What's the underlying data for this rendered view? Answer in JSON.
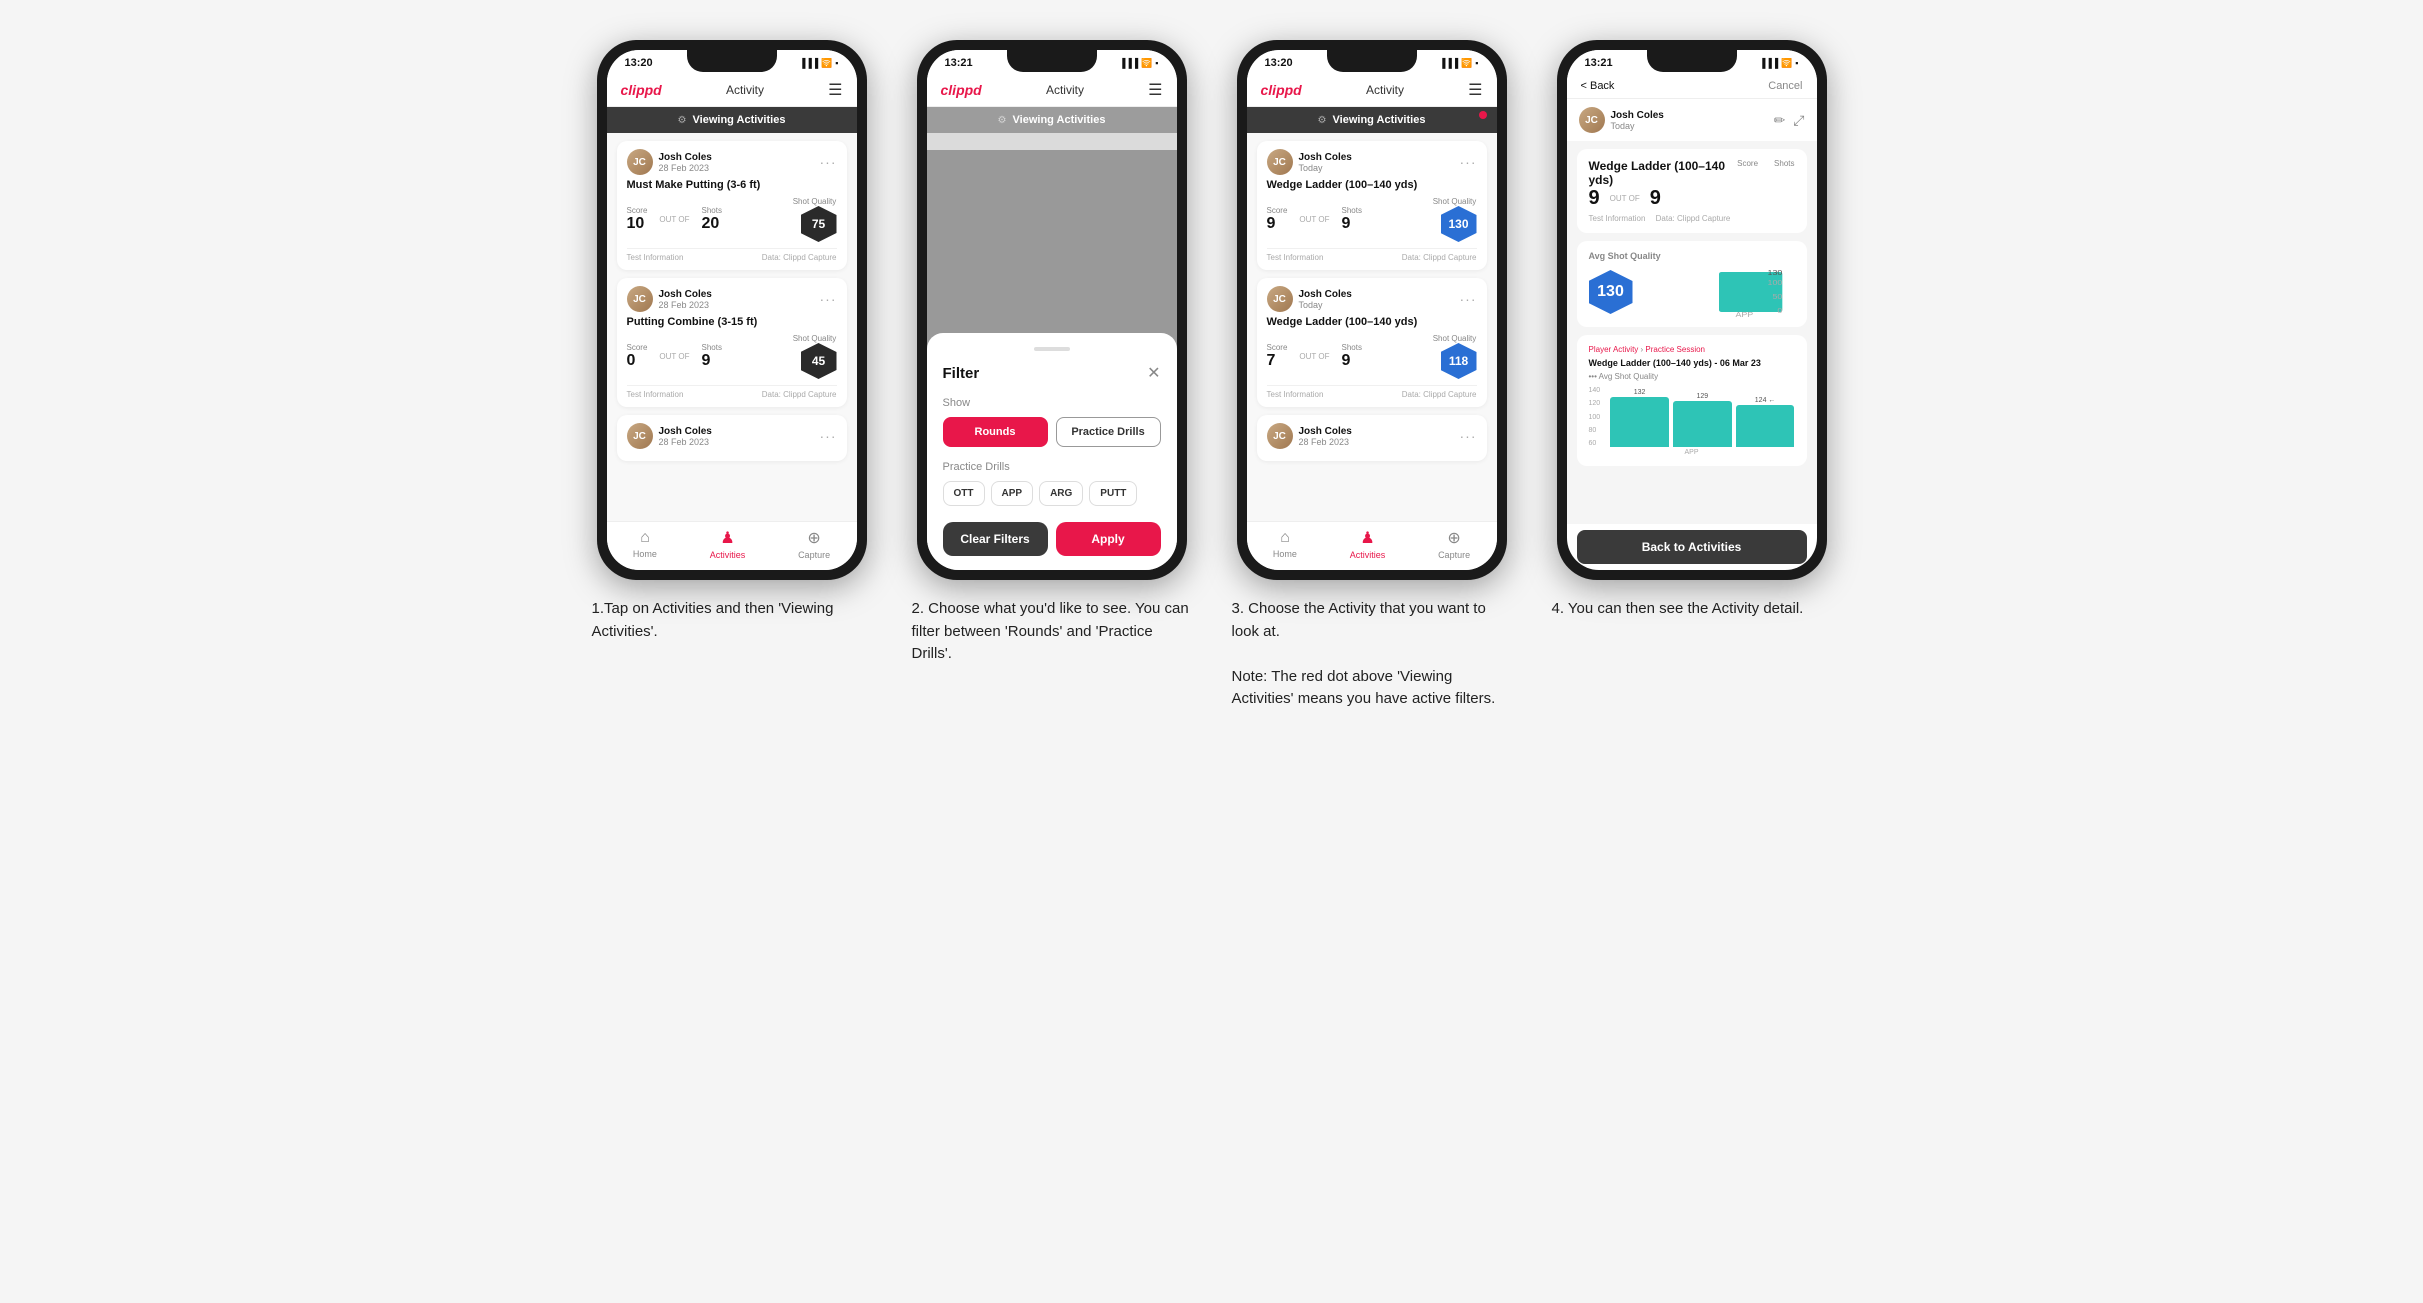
{
  "phones": [
    {
      "id": "phone1",
      "status_time": "13:20",
      "nav_logo": "clippd",
      "nav_title": "Activity",
      "viewing_activities": "Viewing Activities",
      "has_dot": false,
      "cards": [
        {
          "user_name": "Josh Coles",
          "user_date": "28 Feb 2023",
          "activity_title": "Must Make Putting (3-6 ft)",
          "score_label": "Score",
          "score_value": "10",
          "shots_label": "Shots",
          "shots_value": "20",
          "shot_quality_label": "Shot Quality",
          "shot_quality_value": "75",
          "sq_color": "dark",
          "info_left": "Test Information",
          "info_right": "Data: Clippd Capture"
        },
        {
          "user_name": "Josh Coles",
          "user_date": "28 Feb 2023",
          "activity_title": "Putting Combine (3-15 ft)",
          "score_label": "Score",
          "score_value": "0",
          "shots_label": "Shots",
          "shots_value": "9",
          "shot_quality_label": "Shot Quality",
          "shot_quality_value": "45",
          "sq_color": "dark",
          "info_left": "Test Information",
          "info_right": "Data: Clippd Capture"
        },
        {
          "user_name": "Josh Coles",
          "user_date": "28 Feb 2023",
          "activity_title": "",
          "score_label": "",
          "score_value": "",
          "shots_label": "",
          "shots_value": "",
          "shot_quality_label": "",
          "shot_quality_value": "",
          "sq_color": "dark",
          "info_left": "",
          "info_right": ""
        }
      ],
      "bottom_nav": [
        "Home",
        "Activities",
        "Capture"
      ]
    },
    {
      "id": "phone2",
      "status_time": "13:21",
      "nav_logo": "clippd",
      "nav_title": "Activity",
      "viewing_activities": "Viewing Activities",
      "has_dot": false,
      "filter": {
        "title": "Filter",
        "show_label": "Show",
        "rounds_label": "Rounds",
        "practice_drills_label": "Practice Drills",
        "practice_drills_section": "Practice Drills",
        "drill_types": [
          "OTT",
          "APP",
          "ARG",
          "PUTT"
        ],
        "clear_label": "Clear Filters",
        "apply_label": "Apply"
      },
      "bottom_nav": [
        "Home",
        "Activities",
        "Capture"
      ]
    },
    {
      "id": "phone3",
      "status_time": "13:20",
      "nav_logo": "clippd",
      "nav_title": "Activity",
      "viewing_activities": "Viewing Activities",
      "has_dot": true,
      "cards": [
        {
          "user_name": "Josh Coles",
          "user_date": "Today",
          "activity_title": "Wedge Ladder (100–140 yds)",
          "score_label": "Score",
          "score_value": "9",
          "shots_label": "Shots",
          "shots_value": "9",
          "shot_quality_label": "Shot Quality",
          "shot_quality_value": "130",
          "sq_color": "blue",
          "info_left": "Test Information",
          "info_right": "Data: Clippd Capture"
        },
        {
          "user_name": "Josh Coles",
          "user_date": "Today",
          "activity_title": "Wedge Ladder (100–140 yds)",
          "score_label": "Score",
          "score_value": "7",
          "shots_label": "Shots",
          "shots_value": "9",
          "shot_quality_label": "Shot Quality",
          "shot_quality_value": "118",
          "sq_color": "blue",
          "info_left": "Test Information",
          "info_right": "Data: Clippd Capture"
        },
        {
          "user_name": "Josh Coles",
          "user_date": "28 Feb 2023",
          "activity_title": "",
          "score_label": "",
          "score_value": "",
          "shots_label": "",
          "shots_value": "",
          "shot_quality_label": "",
          "shot_quality_value": "",
          "sq_color": "dark",
          "info_left": "",
          "info_right": ""
        }
      ],
      "bottom_nav": [
        "Home",
        "Activities",
        "Capture"
      ]
    },
    {
      "id": "phone4",
      "status_time": "13:21",
      "nav_logo": "",
      "back_label": "< Back",
      "cancel_label": "Cancel",
      "user_name": "Josh Coles",
      "user_date": "Today",
      "detail_title": "Wedge Ladder (100–140 yds)",
      "score_col": "Score",
      "shots_col": "Shots",
      "score_value": "9",
      "out_of": "OUT OF",
      "shots_value": "9",
      "avg_quality_label": "Avg Shot Quality",
      "avg_quality_value": "130",
      "chart_title": "Wedge Ladder (100–140 yds) - 06 Mar 23",
      "chart_subtitle": "••• Avg Shot Quality",
      "chart_bars": [
        132,
        129,
        124
      ],
      "chart_max": 140,
      "chart_y_labels": [
        "140",
        "100",
        "50",
        "0"
      ],
      "chart_x_label": "APP",
      "avg_line_val": 124,
      "practice_label": "Player Activity",
      "practice_session": "Practice Session",
      "back_to_activities": "Back to Activities",
      "info_text": "Test Information",
      "data_text": "Data: Clippd Capture"
    }
  ],
  "captions": [
    "1.Tap on Activities and then 'Viewing Activities'.",
    "2. Choose what you'd like to see. You can filter between 'Rounds' and 'Practice Drills'.",
    "3. Choose the Activity that you want to look at.\n\nNote: The red dot above 'Viewing Activities' means you have active filters.",
    "4. You can then see the Activity detail."
  ]
}
